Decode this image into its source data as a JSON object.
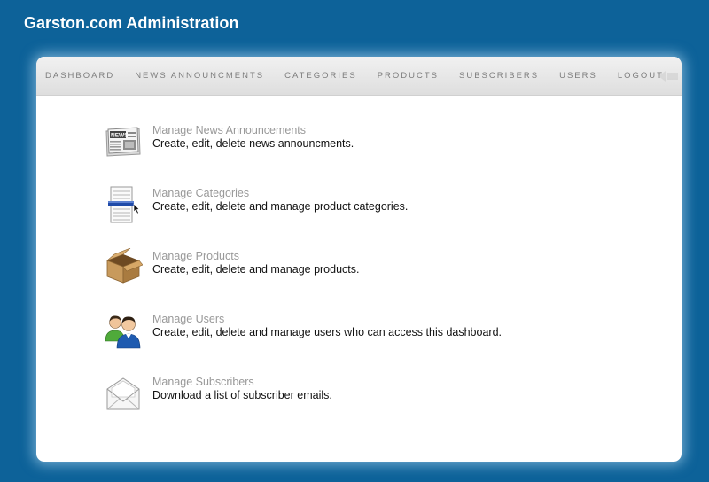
{
  "header": {
    "title": "Garston.com Administration"
  },
  "nav": {
    "items": [
      {
        "label": "DASHBOARD"
      },
      {
        "label": "NEWS ANNOUNCMENTS"
      },
      {
        "label": "CATEGORIES"
      },
      {
        "label": "PRODUCTS"
      },
      {
        "label": "SUBSCRIBERS"
      },
      {
        "label": "USERS"
      },
      {
        "label": "LOGOUT"
      }
    ]
  },
  "dashboard": {
    "items": [
      {
        "title": "Manage News Announcements",
        "description": "Create, edit, delete news announcments.",
        "icon": "newspaper-icon"
      },
      {
        "title": "Manage Categories",
        "description": "Create, edit, delete and manage product categories.",
        "icon": "list-icon"
      },
      {
        "title": "Manage Products",
        "description": "Create, edit, delete and manage products.",
        "icon": "box-icon"
      },
      {
        "title": "Manage Users",
        "description": "Create, edit, delete and manage users who can access this dashboard.",
        "icon": "users-icon"
      },
      {
        "title": "Manage Subscribers",
        "description": "Download a list of subscriber emails.",
        "icon": "envelope-icon"
      }
    ],
    "news_icon_text": "NEWS"
  },
  "colors": {
    "background": "#0d6299",
    "link": "#999999",
    "text": "#111111"
  }
}
